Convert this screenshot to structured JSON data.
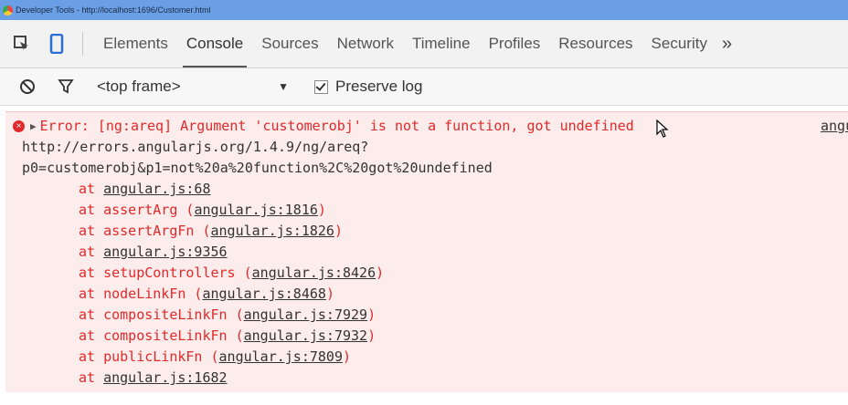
{
  "window": {
    "title": "Developer Tools - http://localhost:1696/Customer.html"
  },
  "tabs": [
    "Elements",
    "Console",
    "Sources",
    "Network",
    "Timeline",
    "Profiles",
    "Resources",
    "Security"
  ],
  "more_label": "»",
  "toolbar": {
    "frame": "<top frame>",
    "dropdown_arrow": "▼",
    "preserve_log": "Preserve log",
    "preserve_log_checked": true
  },
  "console": {
    "error_message": "Error: [ng:areq] Argument 'customerobj' is not a function, got undefined",
    "source_link": "angu",
    "url_line1": "http://errors.angularjs.org/1.4.9/ng/areq?",
    "url_line2": "p0=customerobj&p1=not%20a%20function%2C%20got%20undefined",
    "stack": [
      {
        "fn": "",
        "loc": "angular.js:68"
      },
      {
        "fn": "assertArg",
        "loc": "angular.js:1816"
      },
      {
        "fn": "assertArgFn",
        "loc": "angular.js:1826"
      },
      {
        "fn": "",
        "loc": "angular.js:9356"
      },
      {
        "fn": "setupControllers",
        "loc": "angular.js:8426"
      },
      {
        "fn": "nodeLinkFn",
        "loc": "angular.js:8468"
      },
      {
        "fn": "compositeLinkFn",
        "loc": "angular.js:7929"
      },
      {
        "fn": "compositeLinkFn",
        "loc": "angular.js:7932"
      },
      {
        "fn": "publicLinkFn",
        "loc": "angular.js:7809"
      },
      {
        "fn": "",
        "loc": "angular.js:1682"
      }
    ]
  },
  "colors": {
    "titlebar": "#6a9fe6",
    "error": "#e02a2a",
    "error_bg": "#fdecec"
  }
}
